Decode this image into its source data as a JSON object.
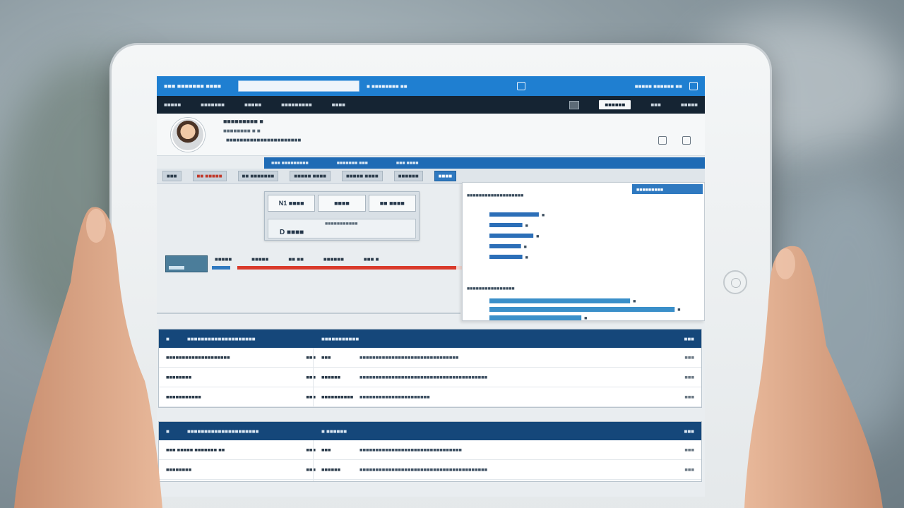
{
  "colors": {
    "accent": "#1f7fd1",
    "navbar": "#152433",
    "table_header": "#15477a",
    "alert": "#d93a2b"
  },
  "topbar": {
    "brand": "■■■ ■■■■■■■ ■■■■",
    "search_placeholder": "",
    "links": [
      "■ ■■■■■■■■ ■■",
      "■■■■■ ■■■■■■ ■■"
    ],
    "icons": [
      "device-icon",
      "tablet-icon"
    ]
  },
  "navbar": {
    "items": [
      "■■■■■",
      "■■■■■■■",
      "■■■■■",
      "■■■■■■■■■",
      "■■■■"
    ],
    "right_button": "■■■■■■",
    "right_items": [
      "■■■",
      "■■■■■"
    ]
  },
  "profile": {
    "name": "■■■■■■■■■ ■",
    "subtitle": "■■■■■■■■ ■ ■",
    "detail": "■■■■■■■■■■■■■■■■■■■■■■"
  },
  "tabs_top": [
    "■■■ ■■■■■■■■■",
    "■■■■■■■ ■■■",
    "■■■ ■■■■"
  ],
  "tabs": [
    "■■■",
    "■■ ■■■■■",
    "■■ ■■■■■■■",
    "■■■■■ ■■■■",
    "■■■■■ ■■■■",
    "■■■■■■",
    "■■■■"
  ],
  "summary": {
    "cards": [
      "N1 ■■■■",
      "■■■■",
      "■■ ■■■■"
    ],
    "label": "D ■■■■",
    "tiny": "■■■■■■■■■■■"
  },
  "progress": {
    "labels": [
      "■■■■■",
      "■■■■■",
      "■■ ■■",
      "■■■■■■",
      "■■■ ■"
    ],
    "value": 0.97
  },
  "chart_data": {
    "type": "bar",
    "orientation": "horizontal",
    "groups": [
      {
        "categories": [
          "■",
          "■",
          "■",
          "■",
          "■"
        ],
        "values": [
          72,
          48,
          64,
          46,
          48
        ]
      },
      {
        "categories": [
          "■",
          "■",
          "■"
        ],
        "values": [
          205,
          270,
          134
        ]
      }
    ],
    "title": "",
    "xlabel": "",
    "ylabel": ""
  },
  "chart_text": {
    "caption1": "■■■■■■■■■■■■■■■■■■■",
    "caption2": "■■■■■■■■■■■■■■■■",
    "legend_tag": "■■■■■■■■■"
  },
  "table1": {
    "headers": [
      "■■■■■■■■■■■■■■■■■■■■",
      "■■■■■■■■■■■",
      "■■■"
    ],
    "rows": [
      {
        "name": "■■■■■■■■■■■■■■■■■■■■",
        "num": "■■■",
        "status": "■■■",
        "detail": "■■■■■■■■■■■■■■■■■■■■■■■■■■■■■■■",
        "end": "■■■"
      },
      {
        "name": "■■■■■■■■",
        "num": "■■■",
        "status": "■■■■■■",
        "detail": "■■■■■■■■■■■■■■■■■■■■■■■■■■■■■■■■■■■■■■■■",
        "end": "■■■"
      },
      {
        "name": "■■■■■■■■■■■",
        "num": "■■■",
        "status": "■■■■■■■■■■",
        "detail": "■■■■■■■■■■■■■■■■■■■■■■",
        "end": "■■■"
      }
    ]
  },
  "table2": {
    "headers": [
      "■■■■■■■■■■■■■■■■■■■■■",
      "■ ■■■■■■",
      "■■■"
    ],
    "rows": [
      {
        "name": "■■■ ■■■■■ ■■■■■■■ ■■",
        "num": "■■■",
        "status": "■■■",
        "detail": "■■■■■■■■■■■■■■■■■■■■■■■■■■■■■■■■",
        "end": "■■■"
      },
      {
        "name": "■■■■■■■■",
        "num": "■■■",
        "status": "■■■■■■",
        "detail": "■■■■■■■■■■■■■■■■■■■■■■■■■■■■■■■■■■■■■■■■",
        "end": "■■■"
      }
    ]
  }
}
